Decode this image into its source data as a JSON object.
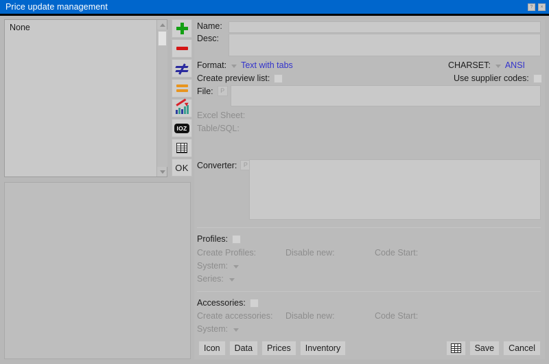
{
  "window": {
    "title": "Price update management",
    "buttons": [
      {
        "name": "help-button",
        "glyph": "?"
      },
      {
        "name": "close-button",
        "glyph": "×"
      }
    ]
  },
  "colors": {
    "titlebar": "#0066cc",
    "panel": "#bbbbbb",
    "field": "#c9c9c9",
    "link": "#3333cc",
    "disabled_text": "#8d8d8d",
    "icon_plus": "#14a014",
    "icon_minus": "#d41616",
    "icon_notequal": "#2b2b9e",
    "icon_equal": "#e8951f",
    "icon_chart_arrow": "#d8222a"
  },
  "left_panel": {
    "list": {
      "items": [
        "None"
      ],
      "scrollbar": {
        "up_arrow": "up-arrow",
        "down_arrow": "down-arrow"
      }
    },
    "lower_panel": {
      "content": ""
    }
  },
  "toolbar": {
    "buttons": [
      {
        "name": "add-button",
        "icon": "plus-icon",
        "label": ""
      },
      {
        "name": "remove-button",
        "icon": "minus-icon",
        "label": ""
      },
      {
        "name": "not-equal-button",
        "icon": "not-equal-icon",
        "label": ""
      },
      {
        "name": "equal-button",
        "icon": "equal-icon",
        "label": ""
      },
      {
        "name": "statistics-button",
        "icon": "bar-chart-arrow-icon",
        "label": ""
      },
      {
        "name": "ioz-button",
        "icon": "ioz-badge-icon",
        "label": "IOZ"
      },
      {
        "name": "table-button",
        "icon": "grid-table-icon",
        "label": ""
      },
      {
        "name": "ok-button",
        "icon": "",
        "label": "OK"
      }
    ]
  },
  "form": {
    "name_label": "Name:",
    "name_value": "",
    "desc_label": "Desc:",
    "desc_value": "",
    "format_label": "Format:",
    "format_value": "Text with tabs",
    "charset_label": "CHARSET:",
    "charset_value": "ANSI",
    "create_preview_label": "Create preview list:",
    "use_supplier_codes_label": "Use supplier codes:",
    "file_label": "File:",
    "file_browse_label": "P",
    "file_value": "",
    "excel_sheet_label": "Excel Sheet:",
    "table_sql_label": "Table/SQL:",
    "converter_label": "Converter:",
    "converter_browse_label": "P",
    "converter_value": ""
  },
  "profiles": {
    "title": "Profiles:",
    "create_label": "Create Profiles:",
    "disable_new_label": "Disable new:",
    "code_start_label": "Code Start:",
    "system_label": "System:",
    "series_label": "Series:"
  },
  "accessories": {
    "title": "Accessories:",
    "create_label": "Create accessories:",
    "disable_new_label": "Disable new:",
    "code_start_label": "Code Start:",
    "system_label": "System:"
  },
  "footer": {
    "buttons": [
      {
        "name": "icon-button",
        "label": "Icon"
      },
      {
        "name": "data-button",
        "label": "Data"
      },
      {
        "name": "prices-button",
        "label": "Prices"
      },
      {
        "name": "inventory-button",
        "label": "Inventory"
      }
    ],
    "grid_icon": "grid-table-icon",
    "save_label": "Save",
    "cancel_label": "Cancel"
  }
}
